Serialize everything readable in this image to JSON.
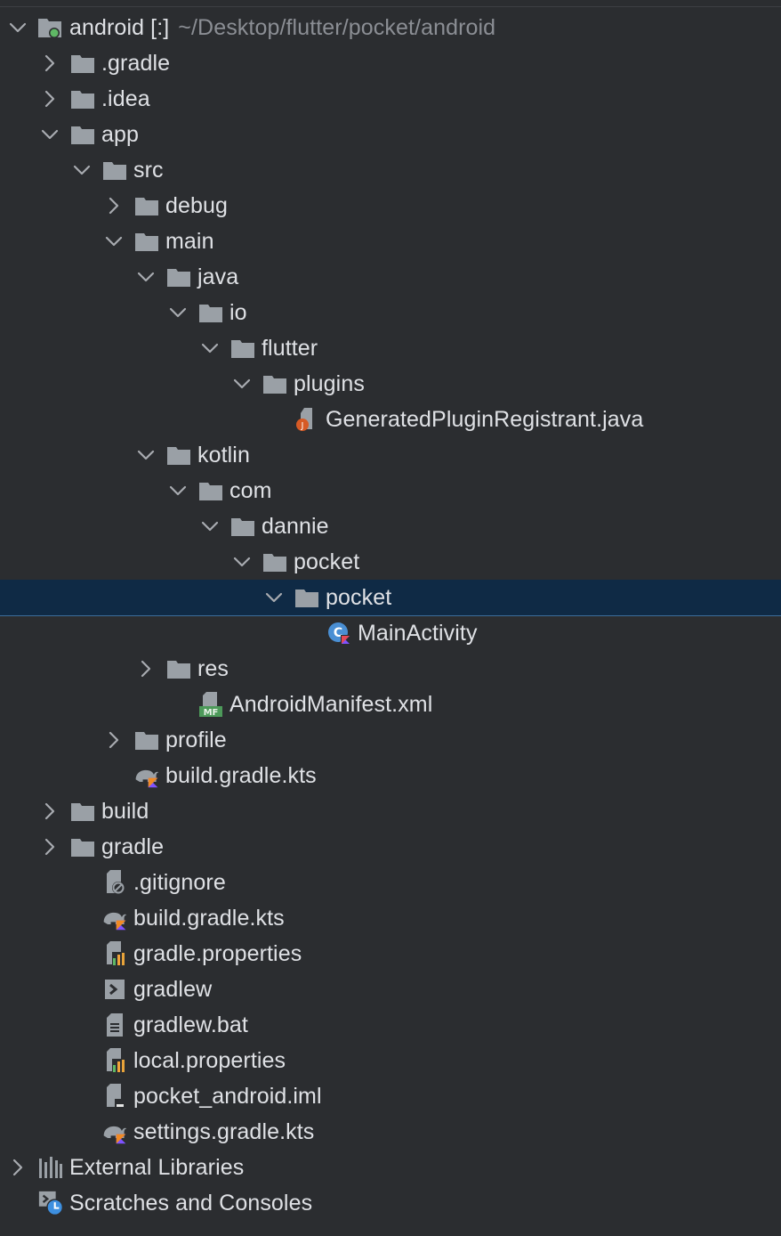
{
  "panel": "Project",
  "colors": {
    "background": "#2b2d30",
    "text": "#dfe1e5",
    "path_text": "#8b8e94",
    "folder": "#9aa0a6",
    "selection": "#0f2a45",
    "kotlin_accent": "#7f52ff",
    "java_badge": "#d65a25",
    "manifest_badge": "#4d9a5a"
  },
  "tree": [
    {
      "depth": 0,
      "label": "android [:]",
      "path": "~/Desktop/flutter/pocket/android",
      "icon": "module-folder-icon",
      "expander": "expanded"
    },
    {
      "depth": 1,
      "label": ".gradle",
      "icon": "folder-icon",
      "expander": "collapsed"
    },
    {
      "depth": 1,
      "label": ".idea",
      "icon": "folder-icon",
      "expander": "collapsed"
    },
    {
      "depth": 1,
      "label": "app",
      "icon": "folder-icon",
      "expander": "expanded"
    },
    {
      "depth": 2,
      "label": "src",
      "icon": "folder-icon",
      "expander": "expanded"
    },
    {
      "depth": 3,
      "label": "debug",
      "icon": "folder-icon",
      "expander": "collapsed"
    },
    {
      "depth": 3,
      "label": "main",
      "icon": "folder-icon",
      "expander": "expanded"
    },
    {
      "depth": 4,
      "label": "java",
      "icon": "folder-icon",
      "expander": "expanded"
    },
    {
      "depth": 5,
      "label": "io",
      "icon": "folder-icon",
      "expander": "expanded"
    },
    {
      "depth": 6,
      "label": "flutter",
      "icon": "folder-icon",
      "expander": "expanded"
    },
    {
      "depth": 7,
      "label": "plugins",
      "icon": "folder-icon",
      "expander": "expanded"
    },
    {
      "depth": 8,
      "label": "GeneratedPluginRegistrant.java",
      "icon": "java-file-icon",
      "expander": "none"
    },
    {
      "depth": 4,
      "label": "kotlin",
      "icon": "folder-icon",
      "expander": "expanded"
    },
    {
      "depth": 5,
      "label": "com",
      "icon": "folder-icon",
      "expander": "expanded"
    },
    {
      "depth": 6,
      "label": "dannie",
      "icon": "folder-icon",
      "expander": "expanded"
    },
    {
      "depth": 7,
      "label": "pocket",
      "icon": "folder-icon",
      "expander": "expanded"
    },
    {
      "depth": 8,
      "label": "pocket",
      "icon": "folder-icon",
      "expander": "expanded",
      "selected": true
    },
    {
      "depth": 9,
      "label": "MainActivity",
      "icon": "kotlin-class-icon",
      "expander": "none"
    },
    {
      "depth": 4,
      "label": "res",
      "icon": "folder-icon",
      "expander": "collapsed"
    },
    {
      "depth": 5,
      "label": "AndroidManifest.xml",
      "icon": "manifest-file-icon",
      "expander": "none"
    },
    {
      "depth": 3,
      "label": "profile",
      "icon": "folder-icon",
      "expander": "collapsed"
    },
    {
      "depth": 3,
      "label": "build.gradle.kts",
      "icon": "gradle-kts-icon",
      "expander": "none"
    },
    {
      "depth": 1,
      "label": "build",
      "icon": "folder-icon",
      "expander": "collapsed"
    },
    {
      "depth": 1,
      "label": "gradle",
      "icon": "folder-icon",
      "expander": "collapsed"
    },
    {
      "depth": 2,
      "label": ".gitignore",
      "icon": "ignore-file-icon",
      "expander": "none"
    },
    {
      "depth": 2,
      "label": "build.gradle.kts",
      "icon": "gradle-kts-icon",
      "expander": "none"
    },
    {
      "depth": 2,
      "label": "gradle.properties",
      "icon": "properties-file-icon",
      "expander": "none"
    },
    {
      "depth": 2,
      "label": "gradlew",
      "icon": "shell-script-icon",
      "expander": "none"
    },
    {
      "depth": 2,
      "label": "gradlew.bat",
      "icon": "text-file-icon",
      "expander": "none"
    },
    {
      "depth": 2,
      "label": "local.properties",
      "icon": "properties-file-icon",
      "expander": "none"
    },
    {
      "depth": 2,
      "label": "pocket_android.iml",
      "icon": "iml-file-icon",
      "expander": "none"
    },
    {
      "depth": 2,
      "label": "settings.gradle.kts",
      "icon": "gradle-kts-icon",
      "expander": "none"
    },
    {
      "depth": 0,
      "label": "External Libraries",
      "icon": "libraries-icon",
      "expander": "collapsed"
    },
    {
      "depth": 0,
      "label": "Scratches and Consoles",
      "icon": "scratches-icon",
      "expander": "none"
    }
  ]
}
